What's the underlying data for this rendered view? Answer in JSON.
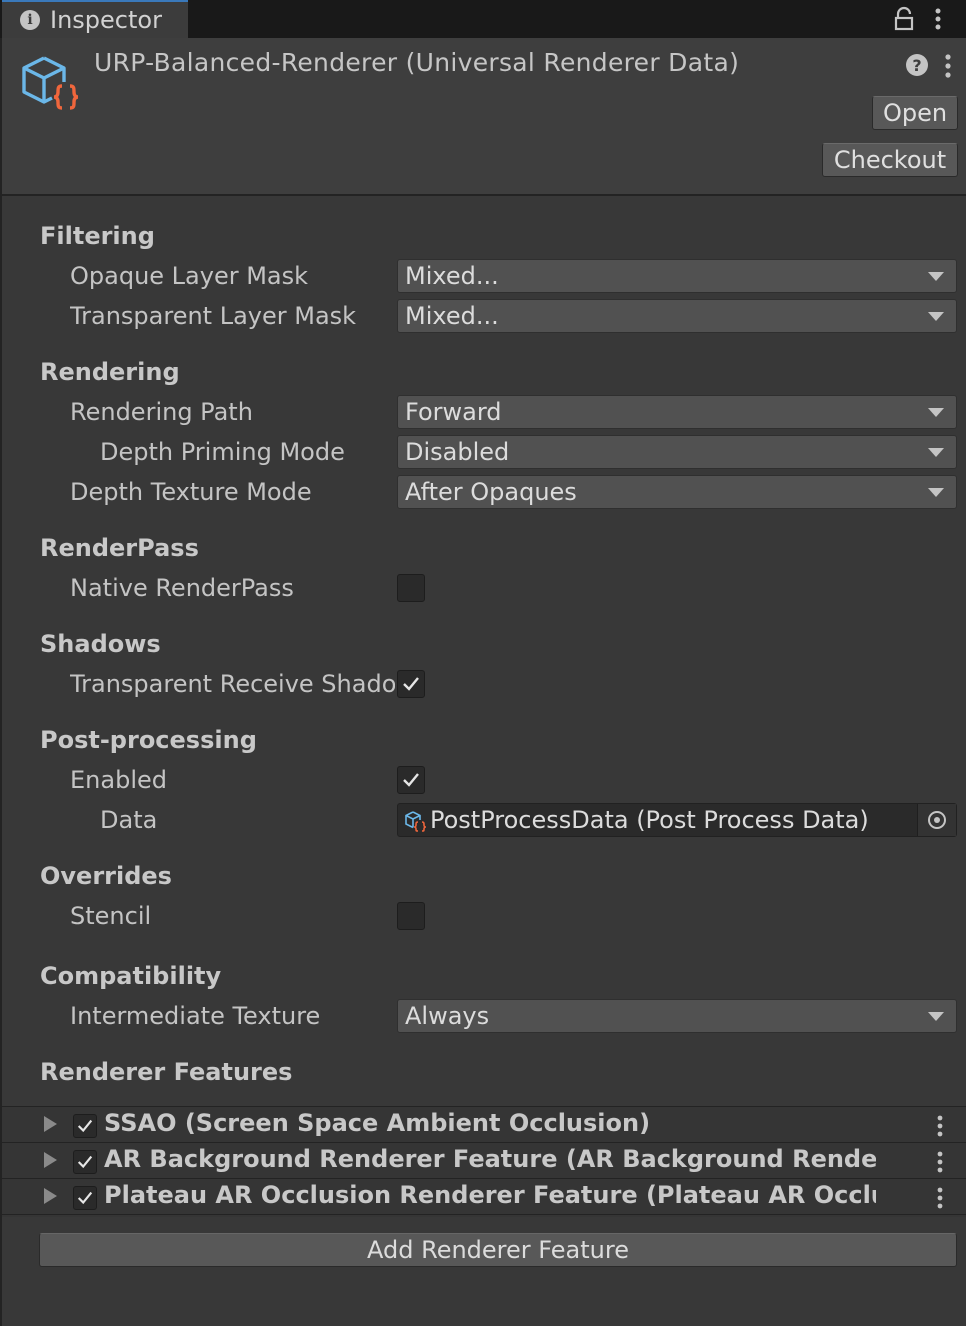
{
  "tab": {
    "title": "Inspector"
  },
  "header": {
    "title": "URP-Balanced-Renderer (Universal Renderer Data)",
    "open_label": "Open",
    "checkout_label": "Checkout"
  },
  "sections": {
    "filtering": {
      "title": "Filtering",
      "opaque_label": "Opaque Layer Mask",
      "opaque_value": "Mixed...",
      "transparent_label": "Transparent Layer Mask",
      "transparent_value": "Mixed..."
    },
    "rendering": {
      "title": "Rendering",
      "path_label": "Rendering Path",
      "path_value": "Forward",
      "priming_label": "Depth Priming Mode",
      "priming_value": "Disabled",
      "depth_label": "Depth Texture Mode",
      "depth_value": "After Opaques"
    },
    "renderpass": {
      "title": "RenderPass",
      "native_label": "Native RenderPass",
      "native_checked": false
    },
    "shadows": {
      "title": "Shadows",
      "receive_label": "Transparent Receive Shadows",
      "receive_checked": true
    },
    "postprocessing": {
      "title": "Post-processing",
      "enabled_label": "Enabled",
      "enabled_checked": true,
      "data_label": "Data",
      "data_value": "PostProcessData (Post Process Data)"
    },
    "overrides": {
      "title": "Overrides",
      "stencil_label": "Stencil",
      "stencil_checked": false
    },
    "compatibility": {
      "title": "Compatibility",
      "intermediate_label": "Intermediate Texture",
      "intermediate_value": "Always"
    },
    "features": {
      "title": "Renderer Features",
      "items": [
        {
          "name": "SSAO (Screen Space Ambient Occlusion)",
          "checked": true
        },
        {
          "name": "AR Background Renderer Feature (AR Background Renderer Feature)",
          "checked": true
        },
        {
          "name": "Plateau AR Occlusion Renderer Feature (Plateau AR Occlusion Renderer Feature)",
          "checked": true
        }
      ],
      "add_label": "Add Renderer Feature"
    }
  },
  "colors": {
    "background": "#383838",
    "accent_orange": "#f0663c",
    "accent_blue": "#6bb7e8"
  }
}
